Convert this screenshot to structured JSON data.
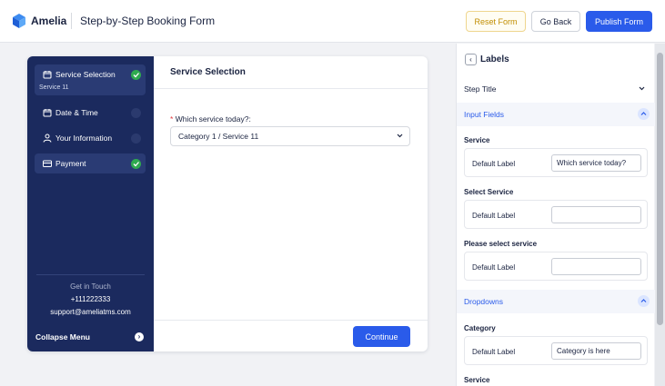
{
  "header": {
    "brand": "Amelia",
    "title": "Step-by-Step Booking Form",
    "reset_label": "Reset Form",
    "back_label": "Go Back",
    "publish_label": "Publish Form"
  },
  "sidebar": {
    "steps": [
      {
        "label": "Service Selection",
        "sub": "Service 11",
        "status": "done",
        "icon": "calendar-icon"
      },
      {
        "label": "Date & Time",
        "status": "pending",
        "icon": "calendar-icon"
      },
      {
        "label": "Your Information",
        "status": "pending",
        "icon": "user-icon"
      },
      {
        "label": "Payment",
        "status": "done",
        "icon": "card-icon"
      }
    ],
    "contact": {
      "heading": "Get in Touch",
      "phone": "+111222333",
      "email": "support@ameliatms.com"
    },
    "collapse_label": "Collapse Menu"
  },
  "main": {
    "title": "Service Selection",
    "question": "Which service today?:",
    "required_mark": "*",
    "selected_value": "Category 1 / Service 11",
    "continue_label": "Continue"
  },
  "panel": {
    "title": "Labels",
    "step_title": "Step Title",
    "input_fields_heading": "Input Fields",
    "fields": [
      {
        "group": "Service",
        "label": "Default Label",
        "value": "Which service today?"
      },
      {
        "group": "Select Service",
        "label": "Default Label",
        "value": ""
      },
      {
        "group": "Please select service",
        "label": "Default Label",
        "value": ""
      }
    ],
    "dropdowns_heading": "Dropdowns",
    "dropdowns": [
      {
        "group": "Category",
        "label": "Default Label",
        "value": "Category is here"
      },
      {
        "group": "Service"
      }
    ]
  },
  "colors": {
    "accent": "#2a5bea",
    "sidebar": "#1b2a5e",
    "success": "#2faa4f",
    "reset": "#c18d00"
  }
}
